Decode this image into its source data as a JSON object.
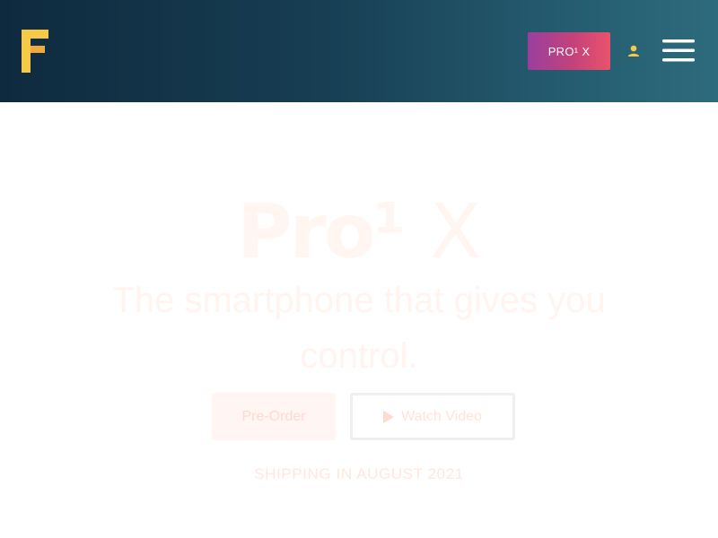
{
  "header": {
    "logo_icon": "fxtec-logo-icon",
    "logo_colors": [
      "#f7c948",
      "#f2a93b"
    ],
    "cta_label": "PRO¹ X",
    "user_icon": "user-icon",
    "menu_icon": "hamburger-menu-icon",
    "accent_gradient": [
      "#9a3f9e",
      "#e9536d"
    ]
  },
  "hero": {
    "title_bold": "Pro¹",
    "title_light": "X",
    "subtitle": "The smartphone that gives you control.",
    "preorder_label": "Pre-Order",
    "watch_video_label": "Watch Video",
    "play_icon": "play-icon",
    "shipping_text": "SHIPPING IN AUGUST 2021"
  }
}
